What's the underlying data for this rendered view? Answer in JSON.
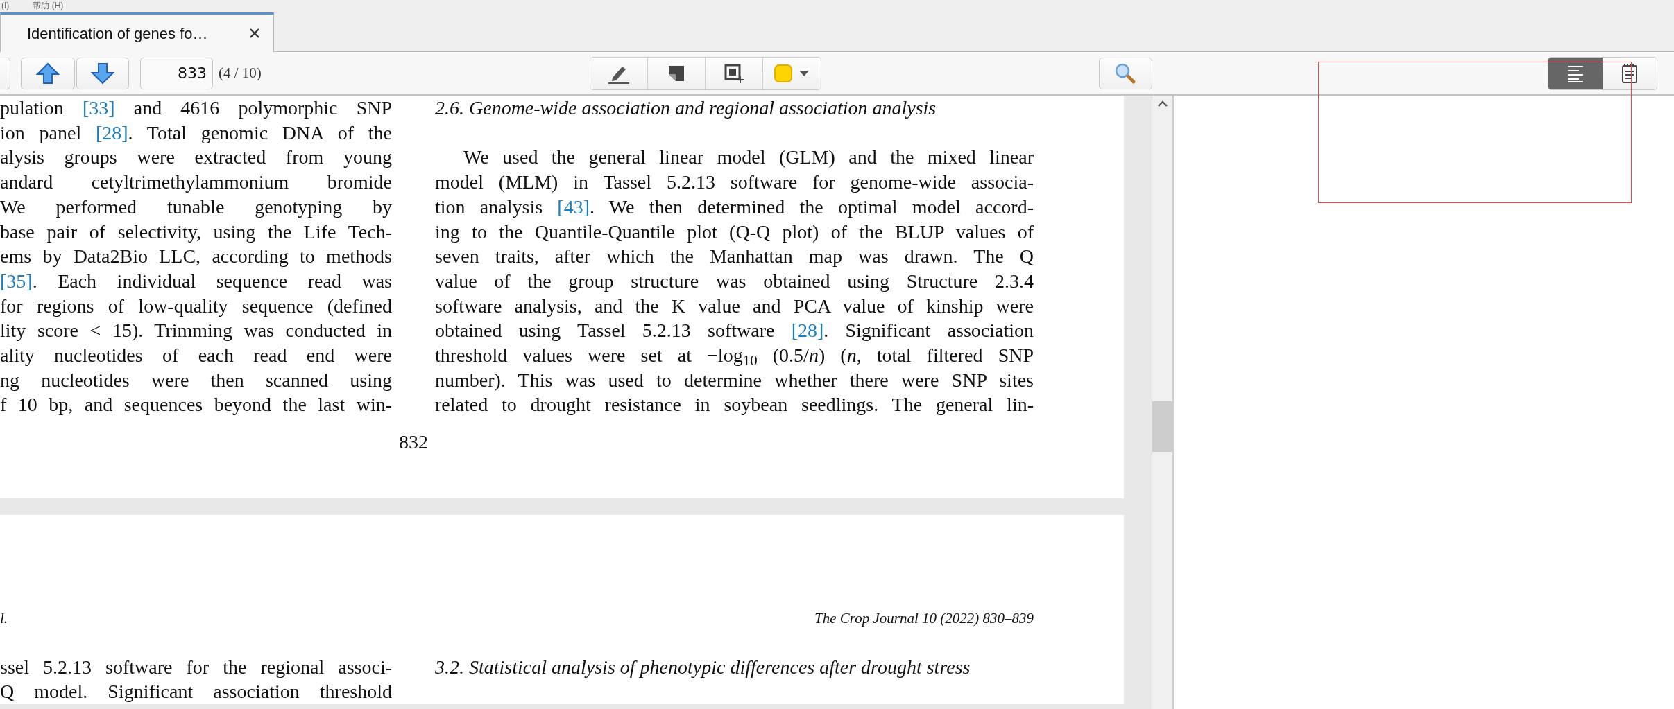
{
  "menu_bar": {
    "items": [
      "(I)",
      "帮助 (H)"
    ]
  },
  "tabs": [
    {
      "title": "Identification of genes fo…",
      "selected": true
    }
  ],
  "toolbar": {
    "page_field": {
      "value": "833"
    },
    "page_count": "(4 / 10)",
    "view_modes": [
      {
        "kind": "outline",
        "selected": true
      },
      {
        "kind": "notes",
        "selected": false
      }
    ]
  },
  "pages": [
    {
      "left_column": {
        "lines": [
          [
            {
              "text": "pulation ",
              "kind": "text"
            },
            {
              "text": "[33]",
              "kind": "citation"
            },
            {
              "text": " and 4616 polymorphic SNP",
              "kind": "text"
            }
          ],
          [
            {
              "text": "ion panel ",
              "kind": "text"
            },
            {
              "text": "[28]",
              "kind": "citation"
            },
            {
              "text": ". Total genomic DNA of the",
              "kind": "text"
            }
          ],
          [
            {
              "text": "alysis groups were extracted from young",
              "kind": "text"
            }
          ],
          [
            {
              "text": "andard cetyltrimethylammonium bromide",
              "kind": "text"
            }
          ],
          [
            {
              "text": "We performed tunable genotyping by",
              "kind": "text"
            }
          ],
          [
            {
              "text": "base pair of selectivity, using the Life Tech-",
              "kind": "text"
            }
          ],
          [
            {
              "text": "ems by Data2Bio LLC, according to methods",
              "kind": "text"
            }
          ],
          [
            {
              "text": "[35]",
              "kind": "citation"
            },
            {
              "text": ". Each individual sequence read was",
              "kind": "text"
            }
          ],
          [
            {
              "text": "for regions of low-quality sequence (defined",
              "kind": "text"
            }
          ],
          [
            {
              "text": "lity score < 15). Trimming was conducted in",
              "kind": "text"
            }
          ],
          [
            {
              "text": "ality nucleotides of each read end were",
              "kind": "text"
            }
          ],
          [
            {
              "text": "ng nucleotides were then scanned using",
              "kind": "text"
            }
          ],
          [
            {
              "text": "f 10 bp, and sequences beyond the last win-",
              "kind": "text"
            }
          ]
        ]
      },
      "right_column": {
        "heading": "2.6. Genome-wide association and regional association analysis",
        "lines": [
          [
            {
              "text": "We used the general linear model (GLM) and the mixed linear",
              "kind": "text"
            }
          ],
          [
            {
              "text": "model (MLM) in Tassel 5.2.13 software for genome-wide associa-",
              "kind": "text"
            }
          ],
          [
            {
              "text": "tion analysis ",
              "kind": "text"
            },
            {
              "text": "[43]",
              "kind": "citation"
            },
            {
              "text": ". We then determined the optimal model accord-",
              "kind": "text"
            }
          ],
          [
            {
              "text": "ing to the Quantile-Quantile plot (Q-Q plot) of the BLUP values of",
              "kind": "text"
            }
          ],
          [
            {
              "text": "seven traits, after which the Manhattan map was drawn. The Q",
              "kind": "text"
            }
          ],
          [
            {
              "text": "value of the group structure was obtained using Structure 2.3.4",
              "kind": "text"
            }
          ],
          [
            {
              "text": "software analysis, and the K value and PCA value of kinship were",
              "kind": "text"
            }
          ],
          [
            {
              "text": "obtained using Tassel 5.2.13 software ",
              "kind": "text"
            },
            {
              "text": "[28]",
              "kind": "citation"
            },
            {
              "text": ". Significant association",
              "kind": "text"
            }
          ],
          [
            {
              "text": "threshold values were set at −log$_{10}$ (0.5/*n*) (*n*, total filtered SNP",
              "kind": "text"
            }
          ],
          [
            {
              "text": "number). This was used to determine whether there were SNP sites",
              "kind": "text"
            }
          ],
          [
            {
              "text": "related to drought resistance in soybean seedlings. The general lin-",
              "kind": "text"
            }
          ]
        ]
      },
      "page_number": "832"
    },
    {
      "header_left": "l.",
      "header_right": "The Crop Journal 10 (2022) 830–839",
      "left_column": {
        "lines": [
          [
            {
              "text": "ssel 5.2.13 software for the regional associ-",
              "kind": "text"
            }
          ],
          [
            {
              "text": "Q model. Significant association threshold",
              "kind": "text"
            }
          ]
        ]
      },
      "right_column": {
        "heading": "3.2. Statistical analysis of phenotypic differences after drought stress"
      }
    }
  ]
}
